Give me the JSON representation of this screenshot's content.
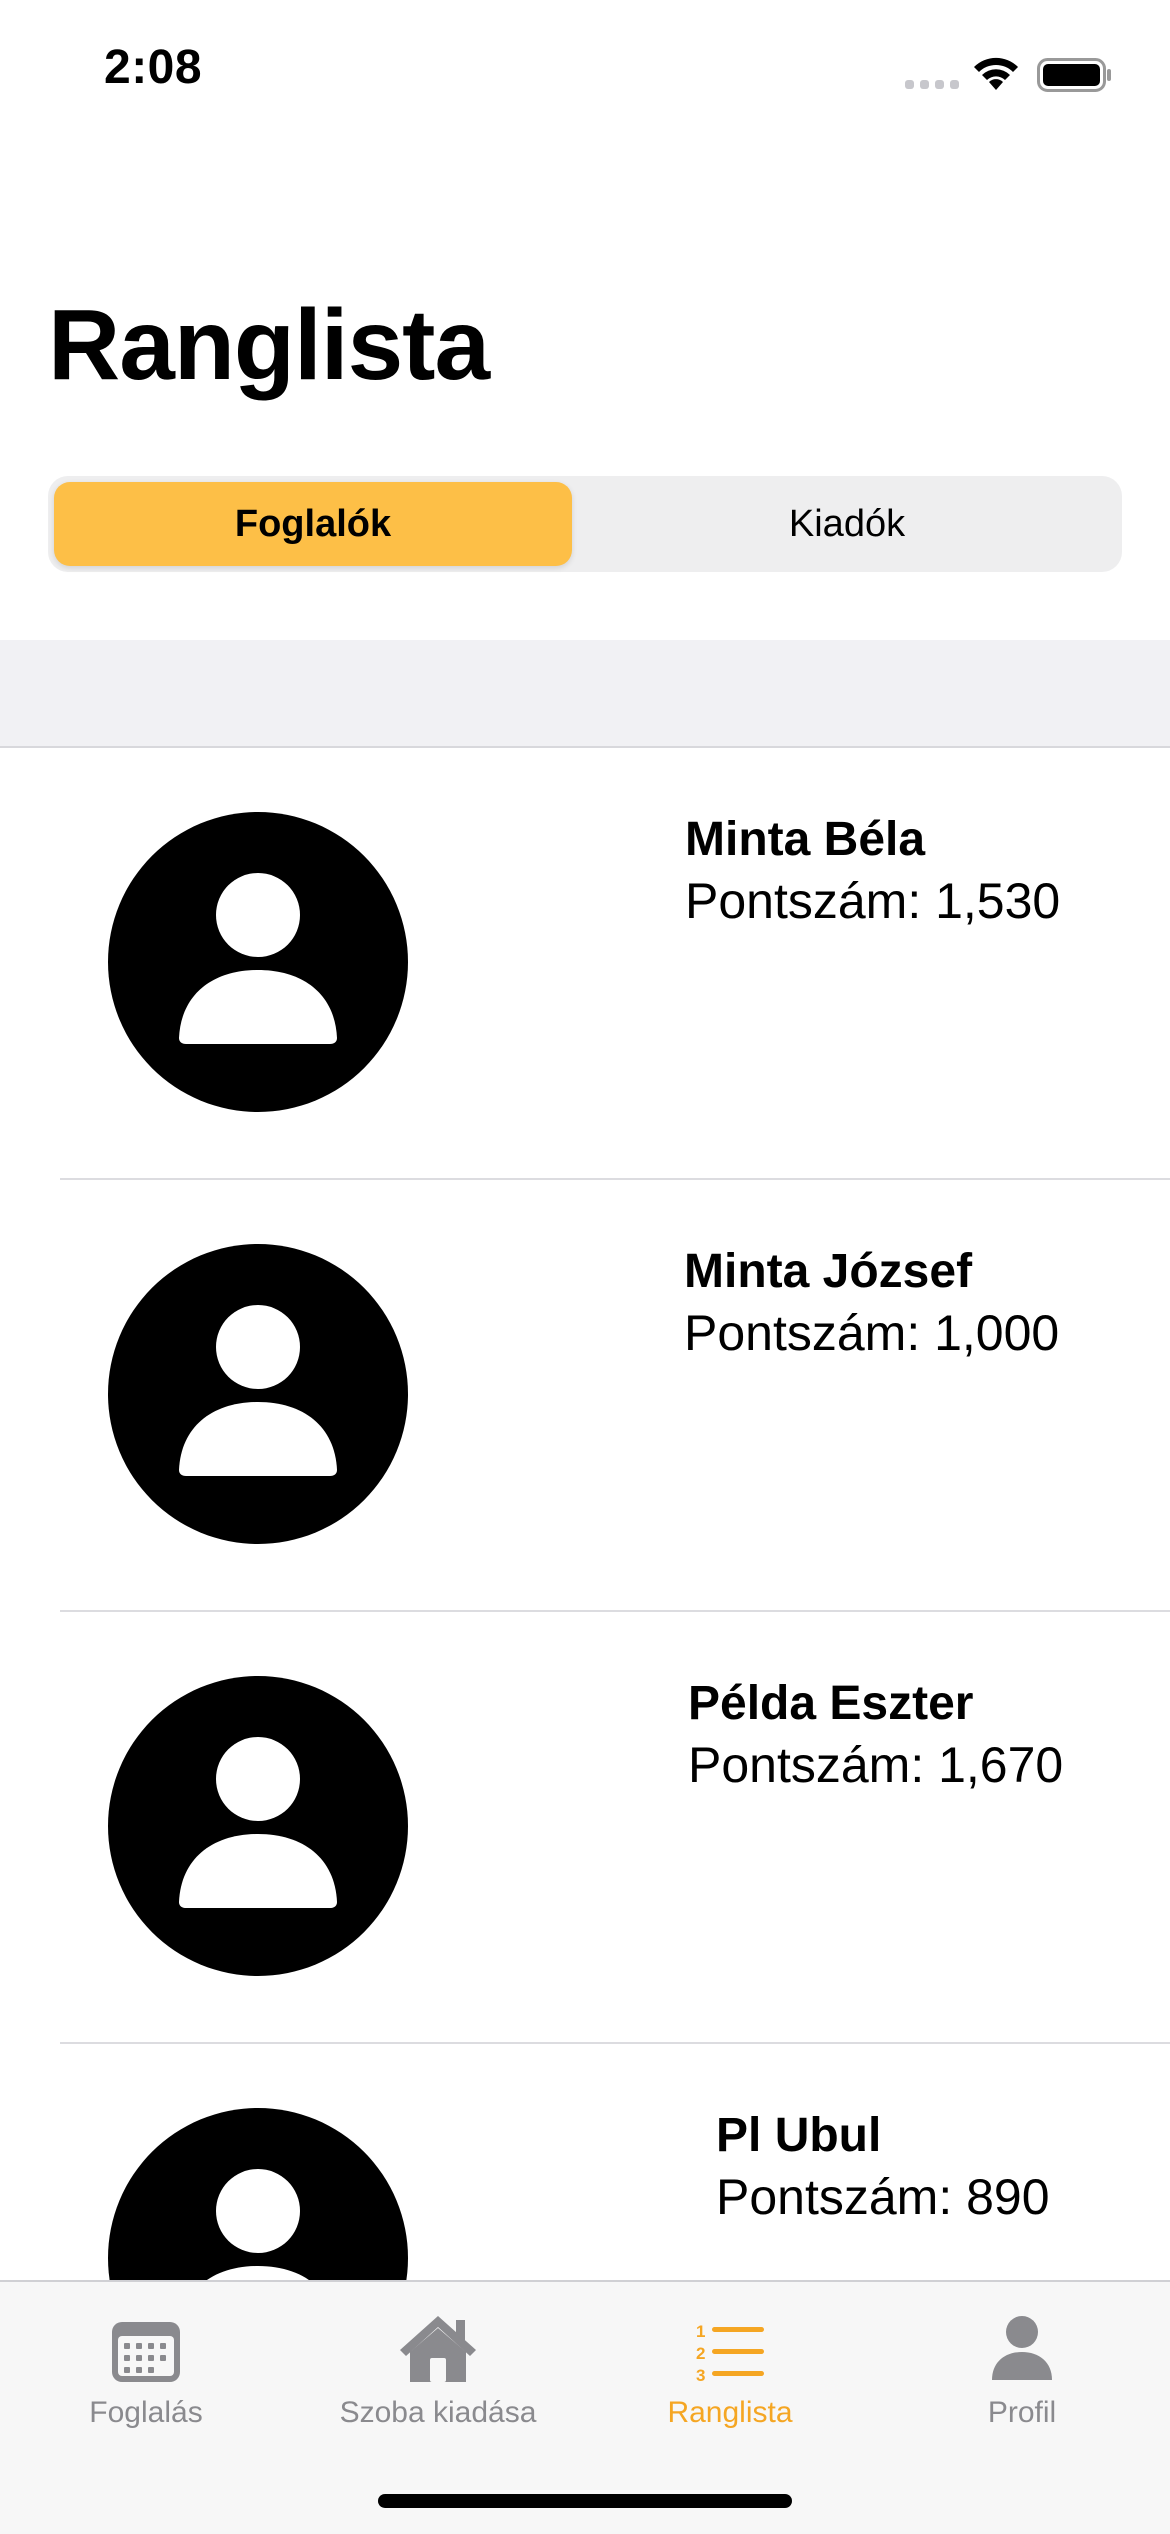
{
  "status_bar": {
    "time": "2:08"
  },
  "page": {
    "title": "Ranglista"
  },
  "segments": {
    "active": "Foglalók",
    "inactive": "Kiadók"
  },
  "leaderboard": [
    {
      "name": "Minta Béla",
      "score": "Pontszám: 1,530"
    },
    {
      "name": "Minta József",
      "score": "Pontszám: 1,000"
    },
    {
      "name": "Példa Eszter",
      "score": "Pontszám: 1,670"
    },
    {
      "name": "Pl Ubul",
      "score": "Pontszám: 890"
    }
  ],
  "tab_bar": {
    "items": [
      {
        "label": "Foglalás",
        "icon": "calendar-icon"
      },
      {
        "label": "Szoba kiadása",
        "icon": "house-icon"
      },
      {
        "label": "Ranglista",
        "icon": "numbered-list-icon",
        "active": true
      },
      {
        "label": "Profil",
        "icon": "person-icon"
      }
    ],
    "active_color": "#f5a623",
    "inactive_color": "#8a8a8e"
  },
  "colors": {
    "segment_active": "#fdbf47"
  }
}
